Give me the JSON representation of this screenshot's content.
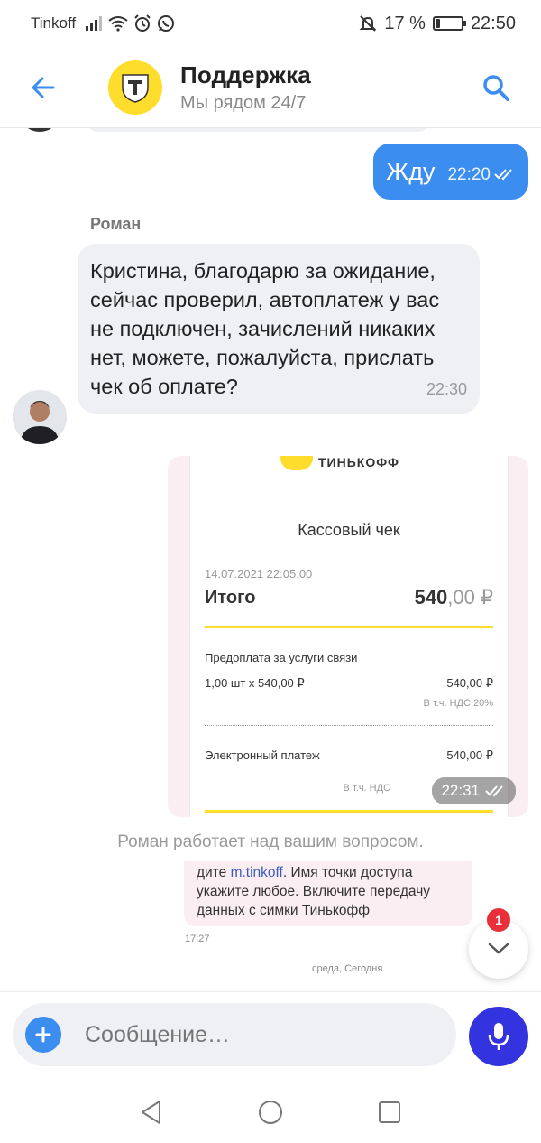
{
  "status_bar": {
    "carrier": "Tinkoff",
    "battery_percent": "17 %",
    "battery_level": 0.17,
    "time": "22:50"
  },
  "header": {
    "title": "Поддержка",
    "subtitle": "Мы рядом 24/7"
  },
  "messages": {
    "outgoing_1": {
      "text": "Жду",
      "time": "22:20"
    },
    "incoming_1": {
      "sender": "Роман",
      "text": "Кристина, благодарю за ожидание, сейчас проверил, автоплатеж у вас не подключен, зачислений никаких нет, можете, пожалуйста, прислать чек об оплате?",
      "time": "22:30"
    },
    "image_1": {
      "time": "22:31",
      "receipt": {
        "brand": "ТИНЬКОФФ",
        "heading": "Кассовый чек",
        "datetime": "14.07.2021 22:05:00",
        "total_label": "Итого",
        "total_int": "540",
        "total_dec": ",00 ₽",
        "item_name": "Предоплата за услуги связи",
        "item_qty": "1,00 шт x 540,00 ₽",
        "item_sum": "540,00 ₽",
        "item_vat": "В т.ч. НДС 20%",
        "payment_label": "Электронный платеж",
        "payment_sum": "540,00 ₽",
        "vat_label": "В т.ч. НДС"
      }
    },
    "status_text": "Роман работает над вашим вопросом.",
    "snippet": {
      "text_before": "дите ",
      "link": "m.tinkoff",
      "text_after": ". Имя точки доступа укажите любое. Включите передачу данных с симки Тинькофф",
      "time": "17:27",
      "date_label": "среда, Сегодня"
    }
  },
  "unread_count": "1",
  "input": {
    "placeholder": "Сообщение…"
  },
  "colors": {
    "accent_blue": "#3b8df0",
    "bubble_gray": "#eef0f3",
    "brand_yellow": "#ffdd2d",
    "mic_blue": "#3333e0",
    "badge_red": "#e8303b"
  }
}
